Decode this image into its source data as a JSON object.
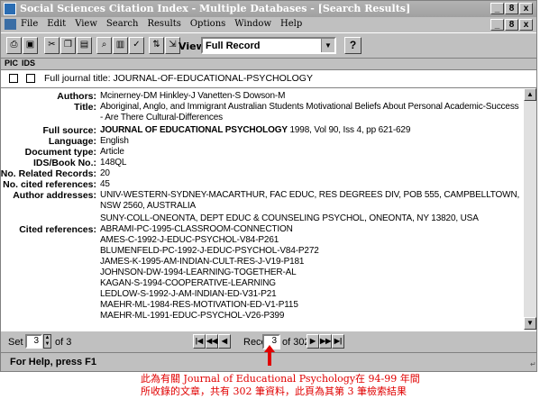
{
  "window": {
    "title": "Social Sciences Citation Index - Multiple Databases - [Search Results]",
    "controls": [
      "_",
      "8",
      "x"
    ]
  },
  "menubar": {
    "items": [
      "File",
      "Edit",
      "View",
      "Search",
      "Results",
      "Options",
      "Window",
      "Help"
    ]
  },
  "toolbar": {
    "view_label": "View:",
    "view_value": "Full Record",
    "help_label": "?"
  },
  "columns": {
    "pic": "PIC",
    "ids": "IDS"
  },
  "journal_row": {
    "text": "Full journal title: JOURNAL-OF-EDUCATIONAL-PSYCHOLOGY"
  },
  "record": {
    "authors": {
      "label": "Authors:",
      "value": "Mcinerney-DM Hinkley-J Vanetten-S Dowson-M"
    },
    "title": {
      "label": "Title:",
      "value": "Aboriginal, Anglo, and Immigrant Australian Students Motivational Beliefs About Personal Academic-Success - Are There Cultural-Differences"
    },
    "full_source": {
      "label": "Full source:",
      "journal": "JOURNAL OF EDUCATIONAL PSYCHOLOGY",
      "rest": " 1998, Vol 90, Iss 4, pp 621-629"
    },
    "language": {
      "label": "Language:",
      "value": "English"
    },
    "document_type": {
      "label": "Document type:",
      "value": "Article"
    },
    "ids_book_no": {
      "label": "IDS/Book No.:",
      "value": "148QL"
    },
    "no_related": {
      "label": "No. Related Records:",
      "value": "20"
    },
    "no_cited": {
      "label": "No. cited references:",
      "value": "45"
    },
    "author_addresses": {
      "label": "Author addresses:",
      "values": [
        "UNIV-WESTERN-SYDNEY-MACARTHUR, FAC EDUC, RES DEGREES DIV, POB 555, CAMPBELLTOWN, NSW 2560, AUSTRALIA",
        "SUNY-COLL-ONEONTA, DEPT EDUC & COUNSELING PSYCHOL, ONEONTA, NY 13820, USA"
      ]
    },
    "cited_references": {
      "label": "Cited references:",
      "values": [
        "ABRAMI-PC-1995-CLASSROOM-CONNECTION",
        "AMES-C-1992-J-EDUC-PSYCHOL-V84-P261",
        "BLUMENFELD-PC-1992-J-EDUC-PSYCHOL-V84-P272",
        "JAMES-K-1995-AM-INDIAN-CULT-RES-J-V19-P181",
        "JOHNSON-DW-1994-LEARNING-TOGETHER-AL",
        "KAGAN-S-1994-COOPERATIVE-LEARNING",
        "LEDLOW-S-1992-J-AM-INDIAN-ED-V31-P21",
        "MAEHR-ML-1984-RES-MOTIVATION-ED-V1-P115",
        "MAEHR-ML-1991-EDUC-PSYCHOL-V26-P399"
      ]
    }
  },
  "navigation": {
    "set_label": "Set",
    "set_value": "3",
    "set_of": "of 3",
    "record_label": "Record:",
    "record_value": "3",
    "record_of": "of 302"
  },
  "status": {
    "text": "For Help, press F1"
  },
  "annotation": {
    "line1": "此為有關 Journal of Educational Psychology在 94-99 年間",
    "line2": "所收錄的文章，共有 302 筆資料，此頁為其第 3 筆檢索結果",
    "color": "#e00000"
  }
}
